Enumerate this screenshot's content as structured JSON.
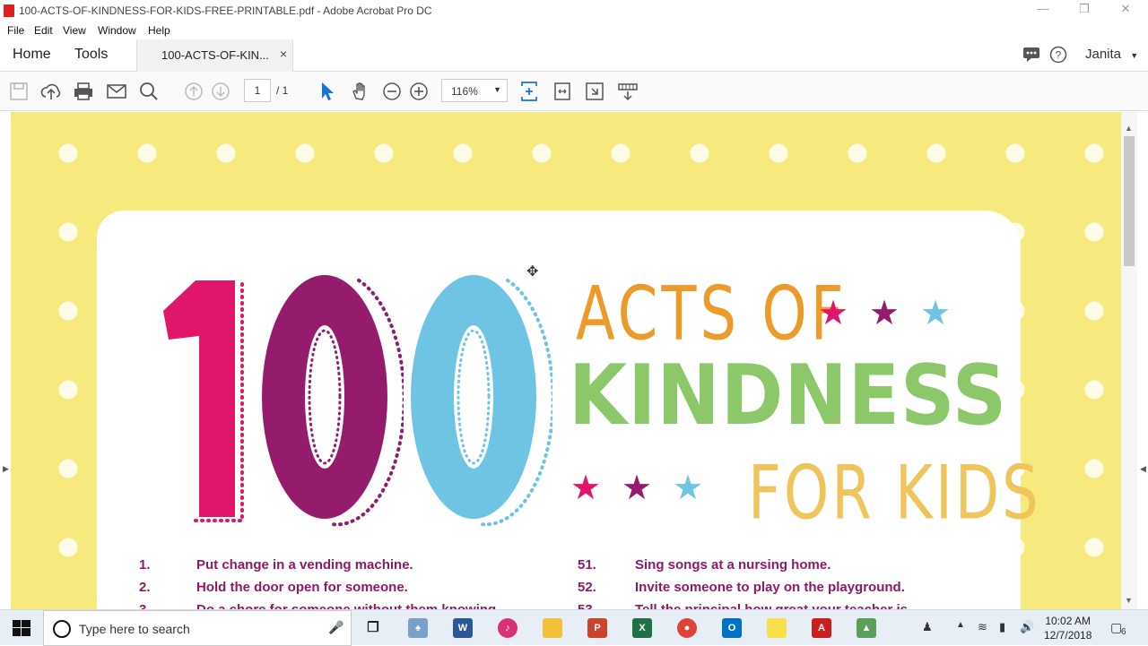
{
  "window": {
    "title": "100-ACTS-OF-KINDNESS-FOR-KIDS-FREE-PRINTABLE.pdf - Adobe Acrobat Pro DC"
  },
  "menu": [
    "File",
    "Edit",
    "View",
    "Window",
    "Help"
  ],
  "tabs": {
    "home": "Home",
    "tools": "Tools",
    "document": "100-ACTS-OF-KIN...",
    "close": "×"
  },
  "user": {
    "name": "Janita"
  },
  "toolbar": {
    "page_current": "1",
    "page_total": "/ 1",
    "zoom": "116%"
  },
  "pdf": {
    "digits": [
      "1",
      "0",
      "0"
    ],
    "line1": "ACTS OF",
    "line2": "KINDNESS",
    "line3": "FOR KIDS",
    "list_left": [
      {
        "num": "1.",
        "text": "Put change in a vending machine."
      },
      {
        "num": "2.",
        "text": "Hold the door open for someone."
      },
      {
        "num": "3.",
        "text": "Do a chore for someone without them knowing."
      }
    ],
    "list_right": [
      {
        "num": "51.",
        "text": "Sing songs at a nursing home."
      },
      {
        "num": "52.",
        "text": "Invite someone to play on the playground."
      },
      {
        "num": "53.",
        "text": "Tell the principal how great your teacher is."
      }
    ],
    "colors": {
      "pink": "#e0166a",
      "plum": "#951c6c",
      "sky": "#6ec4e2",
      "orange": "#ec9a2a",
      "green": "#8cc86a",
      "gold": "#efc45b",
      "bg": "#f6e97e"
    }
  },
  "taskbar": {
    "search_placeholder": "Type here to search",
    "time": "10:02 AM",
    "date": "12/7/2018",
    "notifications": "6"
  }
}
